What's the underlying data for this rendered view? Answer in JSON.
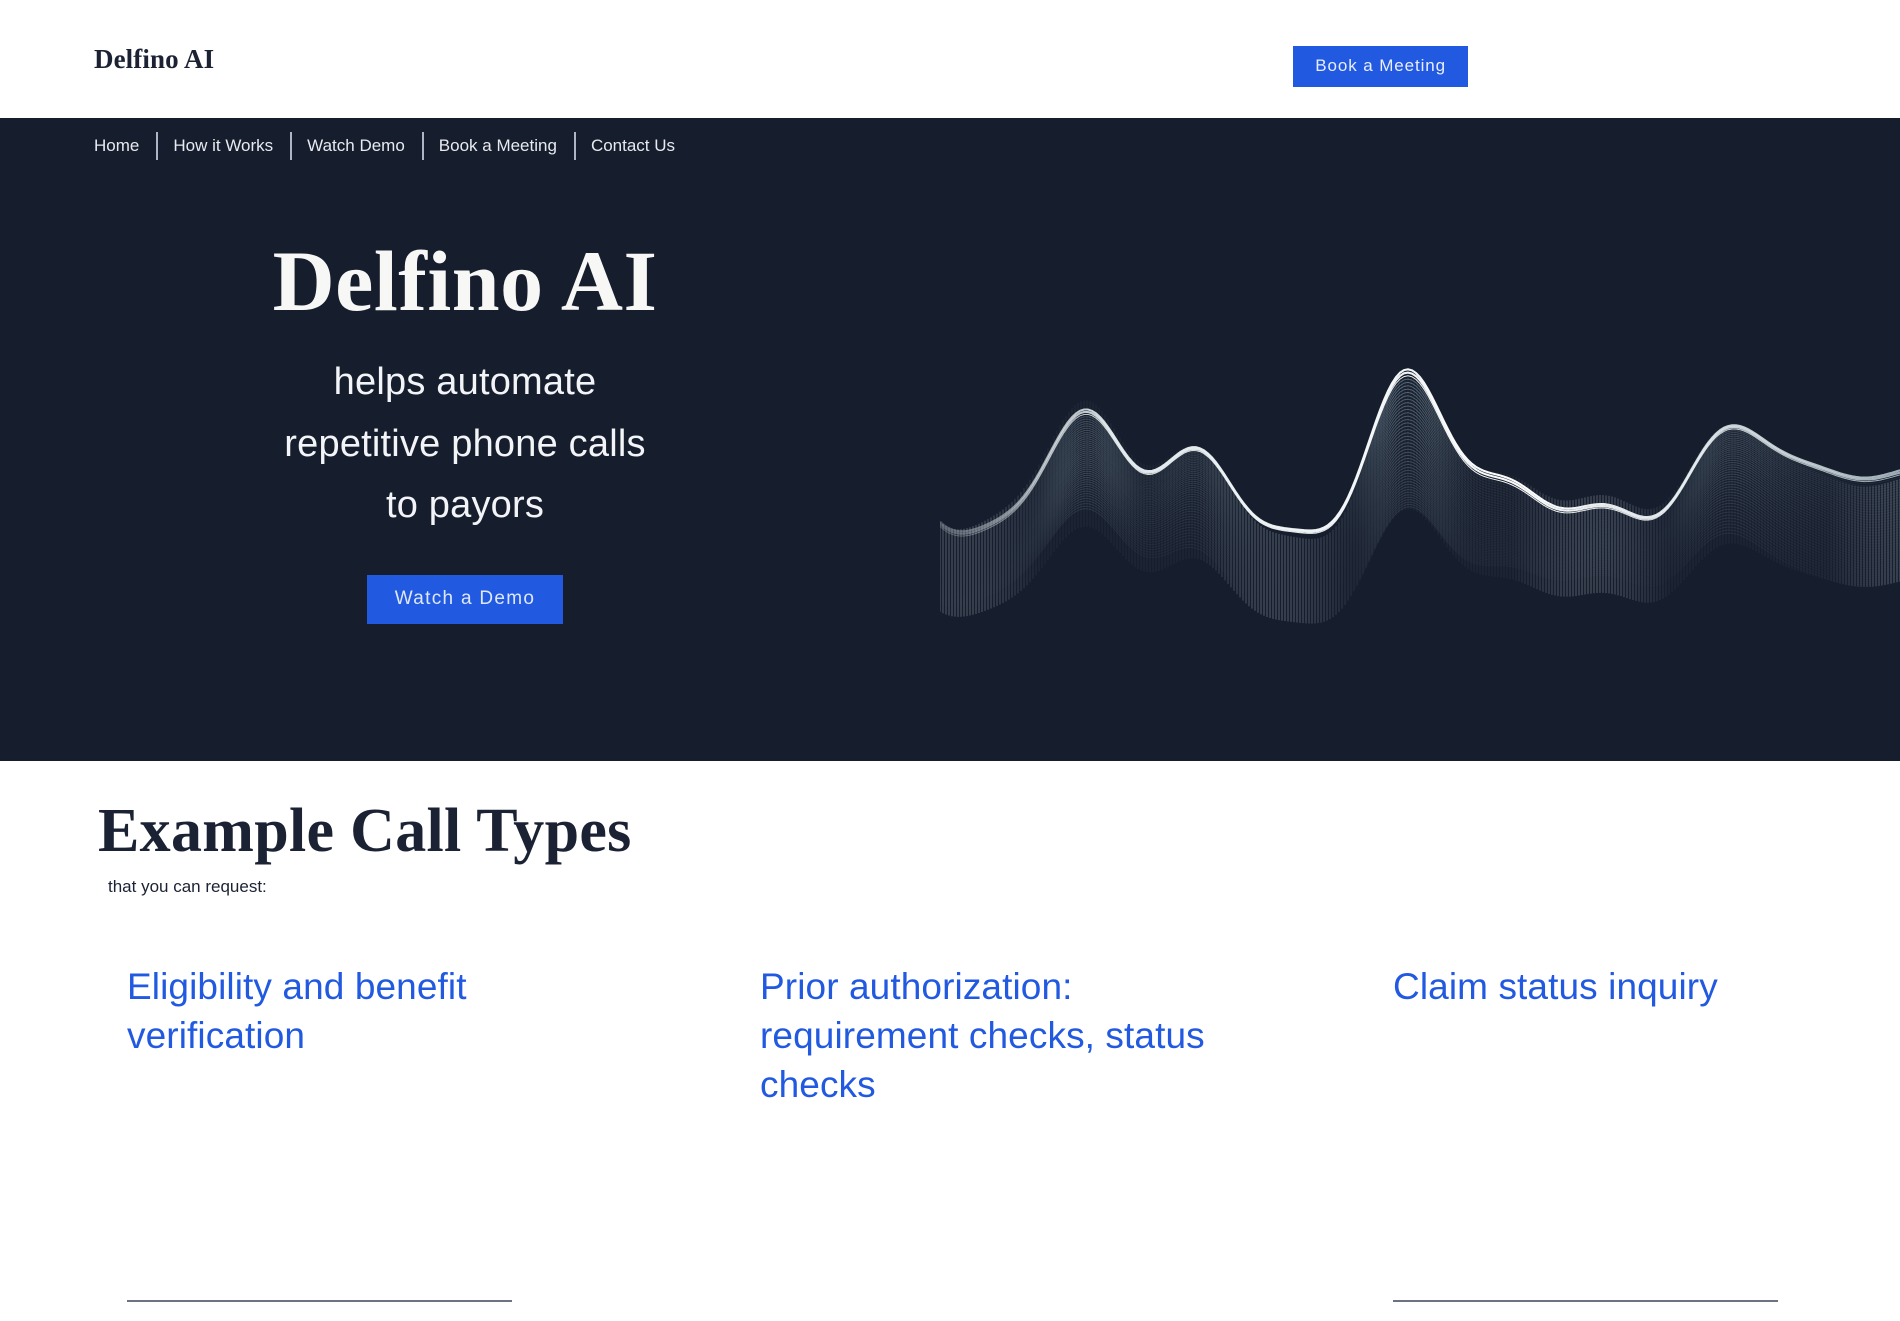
{
  "header": {
    "brand": "Delfino AI",
    "cta_label": "Book a Meeting"
  },
  "nav": {
    "items": [
      {
        "label": "Home"
      },
      {
        "label": "How it Works"
      },
      {
        "label": "Watch Demo"
      },
      {
        "label": "Book a Meeting"
      },
      {
        "label": "Contact Us"
      }
    ]
  },
  "hero": {
    "title": "Delfino AI",
    "subtitle_line1": "helps automate",
    "subtitle_line2": "repetitive phone calls",
    "subtitle_line3": "to payors",
    "cta_label": "Watch a Demo",
    "graphic": "audio-waveform-3d-visual"
  },
  "call_types": {
    "title": "Example Call Types",
    "subtitle": "that you can request:",
    "cards": [
      {
        "title": "Eligibility and benefit verification",
        "has_rule": true
      },
      {
        "title": "Prior authorization: requirement checks, status checks",
        "has_rule": false
      },
      {
        "title": "Claim status inquiry",
        "has_rule": true
      }
    ]
  },
  "colors": {
    "accent_blue": "#2159e0",
    "dark_navy": "#161d2d",
    "text_dark": "#1b2233",
    "rule_gray": "#6b7280",
    "page_white": "#ffffff"
  }
}
